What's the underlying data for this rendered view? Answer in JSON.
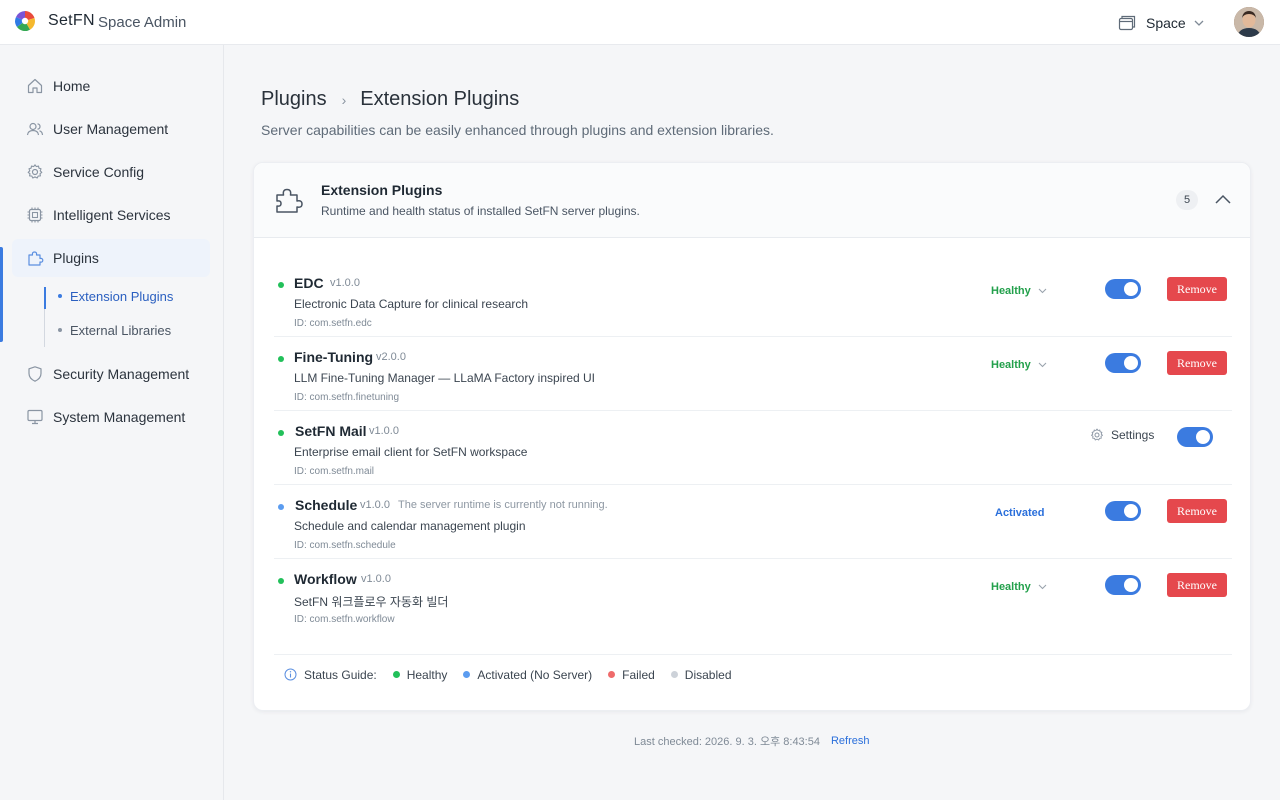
{
  "header": {
    "brand": "SetFN",
    "subtitle": "Space Admin",
    "space_label": "Space",
    "logo_icon": "setfn-logo-icon",
    "avatar_icon": "user-avatar"
  },
  "sidebar": {
    "items": [
      {
        "label": "Home",
        "icon": "home-icon"
      },
      {
        "label": "User Management",
        "icon": "users-icon"
      },
      {
        "label": "Service Config",
        "icon": "gear-icon"
      },
      {
        "label": "Intelligent Services",
        "icon": "chip-icon"
      },
      {
        "label": "Plugins",
        "icon": "puzzle-icon"
      },
      {
        "label": "Security Management",
        "icon": "shield-icon"
      },
      {
        "label": "System Management",
        "icon": "monitor-icon"
      }
    ],
    "sub_items": [
      {
        "label": "Extension Plugins"
      },
      {
        "label": "External Libraries"
      }
    ],
    "active_color": "#3b7be0"
  },
  "page": {
    "breadcrumb_root": "Plugins",
    "breadcrumb_sep": "›",
    "breadcrumb_current": "Extension Plugins",
    "description": "Server capabilities can be easily enhanced through plugins and extension libraries."
  },
  "card": {
    "title": "Extension Plugins",
    "subtitle": "Runtime and health status of installed SetFN server plugins.",
    "count": "5"
  },
  "plugins": [
    {
      "name": "EDC",
      "version": "v1.0.0",
      "note": "",
      "description": "Electronic Data Capture for clinical research",
      "id": "ID: com.setfn.edc",
      "status": "Healthy",
      "status_color": "#22a04b",
      "enabled": true,
      "action": "Remove"
    },
    {
      "name": "Fine-Tuning",
      "version": "v2.0.0",
      "note": "",
      "description": "LLM Fine-Tuning Manager — LLaMA Factory inspired UI",
      "id": "ID: com.setfn.finetuning",
      "status": "Healthy",
      "status_color": "#22a04b",
      "enabled": true,
      "action": "Remove"
    },
    {
      "name": "SetFN Mail",
      "version": "v1.0.0",
      "note": "",
      "description": "Enterprise email client for SetFN workspace",
      "id": "ID: com.setfn.mail",
      "status": "",
      "status_color": "#22a04b",
      "enabled": true,
      "action": "Settings"
    },
    {
      "name": "Schedule",
      "version": "v1.0.0",
      "note": "The server runtime is currently not running.",
      "description": "Schedule and calendar management plugin",
      "id": "ID: com.setfn.schedule",
      "status": "Activated",
      "status_color": "#2a6fdb",
      "enabled": true,
      "action": "Remove"
    },
    {
      "name": "Workflow",
      "version": "v1.0.0",
      "note": "",
      "description": "SetFN 워크플로우 자동화 빌더",
      "id": "ID: com.setfn.workflow",
      "status": "Healthy",
      "status_color": "#22a04b",
      "enabled": true,
      "action": "Remove"
    }
  ],
  "legend": {
    "label": "Status Guide:",
    "items": [
      {
        "label": "Healthy",
        "color": "#22c05a"
      },
      {
        "label": "Activated (No Server)",
        "color": "#5b9cf0"
      },
      {
        "label": "Failed",
        "color": "#ef6b6b"
      },
      {
        "label": "Disabled",
        "color": "#cdd2d9"
      }
    ]
  },
  "footer": {
    "last_checked": "Last checked: 2026. 9. 3. 오후 8:43:54",
    "refresh": "Refresh"
  }
}
